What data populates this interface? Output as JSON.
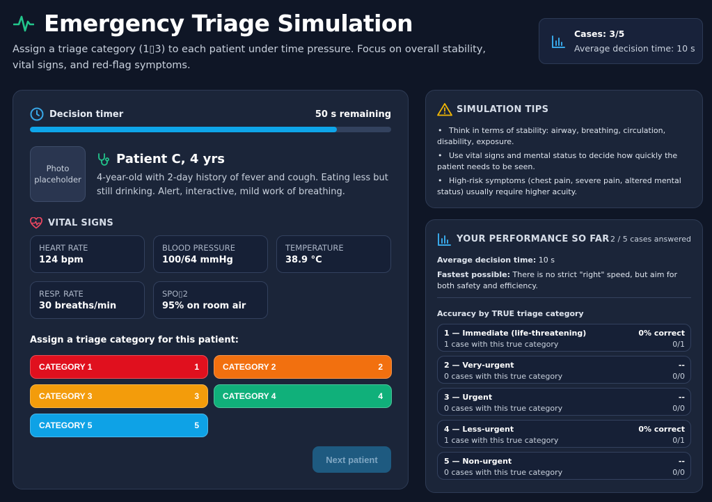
{
  "header": {
    "title": "Emergency Triage Simulation",
    "subtitle": "Assign a triage category (1▯3) to each patient under time pressure. Focus on overall stability, vital signs, and red-flag symptoms.",
    "icon": "pulse-icon",
    "stats": {
      "cases": "Cases: 3/5",
      "avg_time": "Average decision time: 10 s",
      "icon": "bar-chart-icon"
    }
  },
  "timer": {
    "label": "Decision timer",
    "remaining": "50 s remaining",
    "progress_fraction": 0.85,
    "icon": "clock-icon"
  },
  "patient": {
    "photo_placeholder": "Photo placeholder",
    "name": "Patient C, 4 yrs",
    "description": "4-year-old with 2-day history of fever and cough. Eating less but still drinking. Alert, interactive, mild work of breathing.",
    "icon": "stethoscope-icon"
  },
  "vitals": {
    "title": "VITAL SIGNS",
    "icon": "heart-pulse-icon",
    "items": [
      {
        "label": "HEART RATE",
        "value": "124 bpm"
      },
      {
        "label": "BLOOD PRESSURE",
        "value": "100/64 mmHg"
      },
      {
        "label": "TEMPERATURE",
        "value": "38.9 °C"
      },
      {
        "label": "RESP. RATE",
        "value": "30 breaths/min"
      },
      {
        "label": "SPO▯2",
        "value": "95% on room air"
      }
    ]
  },
  "assign": {
    "label": "Assign a triage category for this patient:",
    "categories": [
      {
        "label": "CATEGORY 1",
        "num": "1",
        "color": "#e0101e"
      },
      {
        "label": "CATEGORY 2",
        "num": "2",
        "color": "#f2700f"
      },
      {
        "label": "CATEGORY 3",
        "num": "3",
        "color": "#f39c0b"
      },
      {
        "label": "CATEGORY 4",
        "num": "4",
        "color": "#10b07a"
      },
      {
        "label": "CATEGORY 5",
        "num": "5",
        "color": "#0ea2e6"
      }
    ],
    "next_label": "Next patient"
  },
  "tips": {
    "title": "SIMULATION TIPS",
    "icon": "warning-icon",
    "bullet": "•",
    "items": [
      "Think in terms of stability: airway, breathing, circulation, disability, exposure.",
      "Use vital signs and mental status to decide how quickly the patient needs to be seen.",
      "High-risk symptoms (chest pain, severe pain, altered mental status) usually require higher acuity."
    ]
  },
  "performance": {
    "title": "YOUR PERFORMANCE SO FAR",
    "icon": "bar-chart-icon",
    "answered": "2 / 5 cases answered",
    "avg_label": "Average decision time:",
    "avg_value": "10 s",
    "fastest_label": "Fastest possible:",
    "fastest_text": "There is no strict \"right\" speed, but aim for both safety and efficiency.",
    "accuracy_title": "Accuracy by TRUE triage category",
    "rows": [
      {
        "name": "1 — Immediate (life-threatening)",
        "pct": "0% correct",
        "count": "1 case with this true category",
        "frac": "0/1"
      },
      {
        "name": "2 — Very-urgent",
        "pct": "--",
        "count": "0 cases with this true category",
        "frac": "0/0"
      },
      {
        "name": "3 — Urgent",
        "pct": "--",
        "count": "0 cases with this true category",
        "frac": "0/0"
      },
      {
        "name": "4 — Less-urgent",
        "pct": "0% correct",
        "count": "1 case with this true category",
        "frac": "0/1"
      },
      {
        "name": "5 — Non-urgent",
        "pct": "--",
        "count": "0 cases with this true category",
        "frac": "0/0"
      }
    ]
  }
}
